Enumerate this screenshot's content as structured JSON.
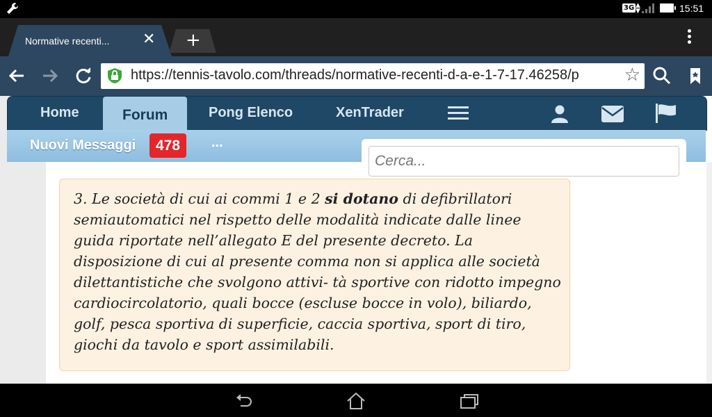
{
  "status_bar": {
    "network": "3G",
    "time": "15:51",
    "icons": [
      "wrench-icon",
      "signal-icon",
      "battery-icon"
    ]
  },
  "browser": {
    "tab_title": "Normative recenti...",
    "tab_close": "✕",
    "new_tab": "+",
    "url": "https://tennis-tavolo.com/threads/normative-recenti-d-a-e-1-7-17.46258/p",
    "icons": [
      "back-icon",
      "forward-icon",
      "reload-icon",
      "lock-icon",
      "star-icon",
      "search-icon",
      "bookmark-icon",
      "overflow-menu-icon"
    ]
  },
  "site_nav": {
    "items": [
      "Home",
      "Forum",
      "Pong Elenco",
      "XenTrader"
    ],
    "active": "Forum",
    "icons": [
      "hamburger-icon",
      "user-icon",
      "mail-icon",
      "flag-icon"
    ]
  },
  "sub_nav": {
    "new_messages_label": "Nuovi Messaggi",
    "new_messages_count": "478",
    "more": "..."
  },
  "search": {
    "placeholder": "Cerca..."
  },
  "quote": {
    "before_bold": "3. Le società di cui ai commi 1 e 2 ",
    "bold": "si dotano",
    "after_bold": " di defibrillatori semiautomatici nel rispetto delle modalità indicate dalle linee guida riportate nell’allegato E del presente decreto. La disposizione di cui al presente comma non si applica alle società dilettantistiche che svolgono attivi- tà sportive con ridotto impegno cardiocircolatorio, quali bocce (escluse bocce in volo), biliardo, golf, pesca sportiva di superficie, caccia sportiva, sport di tiro, giochi da tavolo e sport assimilabili."
  },
  "system_nav": {
    "icons": [
      "back-nav-icon",
      "home-nav-icon",
      "recents-nav-icon"
    ]
  },
  "colors": {
    "toolbar": "#2d4760",
    "site_nav": "#1f4766",
    "active_tab": "#a7cde6",
    "sub_nav": "#9ec7e4",
    "badge": "#e3262a",
    "quote_bg": "#fdf2e2"
  }
}
